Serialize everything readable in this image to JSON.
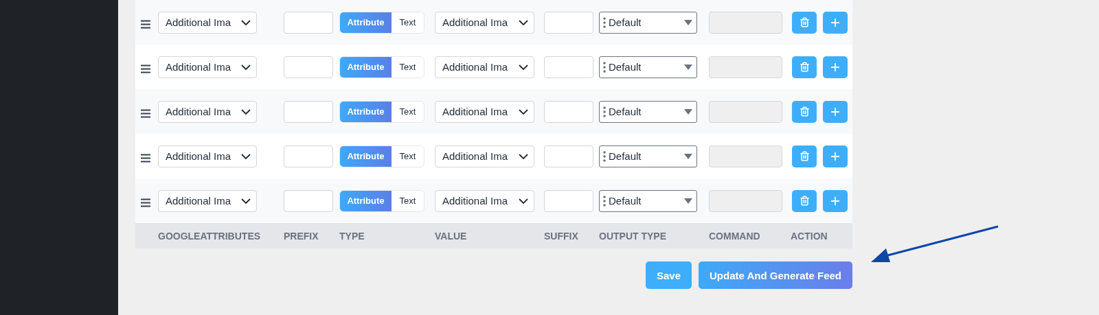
{
  "rows": [
    {
      "attribute": "Additional Ima",
      "type_options": [
        {
          "label": "Attribute",
          "selected": true
        },
        {
          "label": "Text",
          "selected": false
        }
      ],
      "value": "Additional Ima",
      "output_type": "Default"
    },
    {
      "attribute": "Additional Ima",
      "type_options": [
        {
          "label": "Attribute",
          "selected": true
        },
        {
          "label": "Text",
          "selected": false
        }
      ],
      "value": "Additional Ima",
      "output_type": "Default"
    },
    {
      "attribute": "Additional Ima",
      "type_options": [
        {
          "label": "Attribute",
          "selected": true
        },
        {
          "label": "Text",
          "selected": false
        }
      ],
      "value": "Additional Ima",
      "output_type": "Default"
    },
    {
      "attribute": "Additional Ima",
      "type_options": [
        {
          "label": "Attribute",
          "selected": true
        },
        {
          "label": "Text",
          "selected": false
        }
      ],
      "value": "Additional Ima",
      "output_type": "Default"
    },
    {
      "attribute": "Additional Ima",
      "type_options": [
        {
          "label": "Attribute",
          "selected": true
        },
        {
          "label": "Text",
          "selected": false
        }
      ],
      "value": "Additional Ima",
      "output_type": "Default"
    }
  ],
  "columns": [
    "GOOGLEATTRIBUTES",
    "PREFIX",
    "TYPE",
    "VALUE",
    "SUFFIX",
    "OUTPUT TYPE",
    "COMMAND",
    "ACTION"
  ],
  "buttons": [
    {
      "label": "Save",
      "kind": "plain"
    },
    {
      "label": "Update And Generate Feed",
      "kind": "gradient"
    }
  ]
}
